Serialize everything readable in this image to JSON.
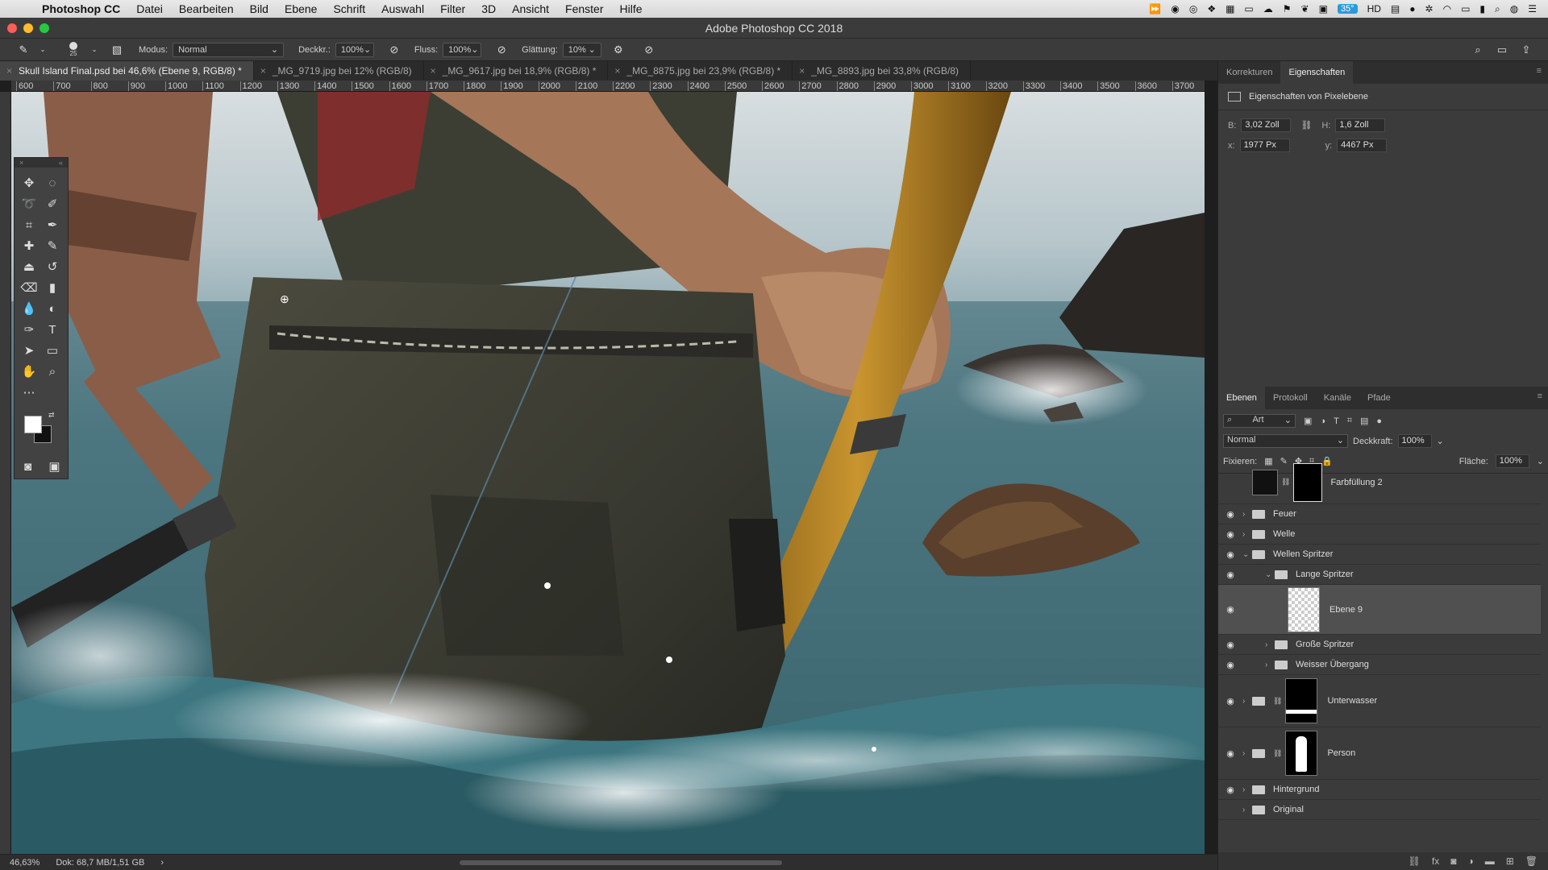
{
  "menubar": {
    "app_name": "Photoshop CC",
    "items": [
      "Datei",
      "Bearbeiten",
      "Bild",
      "Ebene",
      "Schrift",
      "Auswahl",
      "Filter",
      "3D",
      "Ansicht",
      "Fenster",
      "Hilfe"
    ],
    "battery_badge": "35°"
  },
  "window": {
    "title": "Adobe Photoshop CC 2018"
  },
  "options": {
    "brush_size": "25",
    "mode_label": "Modus:",
    "mode_value": "Normal",
    "opacity_label": "Deckkr.:",
    "opacity_value": "100%",
    "flow_label": "Fluss:",
    "flow_value": "100%",
    "smoothing_label": "Glättung:",
    "smoothing_value": "10%"
  },
  "tabs": [
    {
      "label": "Skull Island Final.psd bei 46,6% (Ebene 9, RGB/8) *"
    },
    {
      "label": "_MG_9719.jpg bei 12% (RGB/8)"
    },
    {
      "label": "_MG_9617.jpg bei 18,9% (RGB/8) *"
    },
    {
      "label": "_MG_8875.jpg bei 23,9% (RGB/8) *"
    },
    {
      "label": "_MG_8893.jpg bei 33,8% (RGB/8)"
    }
  ],
  "ruler": {
    "h_ticks": [
      "600",
      "700",
      "800",
      "900",
      "1000",
      "1100",
      "1200",
      "1300",
      "1400",
      "1500",
      "1600",
      "1700",
      "1800",
      "1900",
      "2000",
      "2100",
      "2200",
      "2300",
      "2400",
      "2500",
      "2600",
      "2700",
      "2800",
      "2900",
      "3000",
      "3100",
      "3200",
      "3300",
      "3400",
      "3500",
      "3600",
      "3700"
    ]
  },
  "status": {
    "zoom": "46,63%",
    "doc": "Dok: 68,7 MB/1,51 GB"
  },
  "props": {
    "tabs": [
      "Korrekturen",
      "Eigenschaften"
    ],
    "title": "Eigenschaften von Pixelebene",
    "w_label": "B:",
    "w_value": "3,02 Zoll",
    "h_label": "H:",
    "h_value": "1,6 Zoll",
    "x_label": "x:",
    "x_value": "1977 Px",
    "y_label": "y:",
    "y_value": "4467 Px"
  },
  "layers": {
    "tabs": [
      "Ebenen",
      "Protokoll",
      "Kanäle",
      "Pfade"
    ],
    "filter_label": "Art",
    "blend": "Normal",
    "opacity_label": "Deckkraft:",
    "opacity_value": "100%",
    "lock_label": "Fixieren:",
    "fill_label": "Fläche:",
    "fill_value": "100%",
    "items": [
      {
        "name": "Farbfüllung 2"
      },
      {
        "name": "Feuer"
      },
      {
        "name": "Welle"
      },
      {
        "name": "Wellen Spritzer"
      },
      {
        "name": "Lange Spritzer"
      },
      {
        "name": "Ebene 9"
      },
      {
        "name": "Große Spritzer"
      },
      {
        "name": "Weisser Übergang"
      },
      {
        "name": "Unterwasser"
      },
      {
        "name": "Person"
      },
      {
        "name": "Hintergrund"
      },
      {
        "name": "Original"
      }
    ]
  }
}
